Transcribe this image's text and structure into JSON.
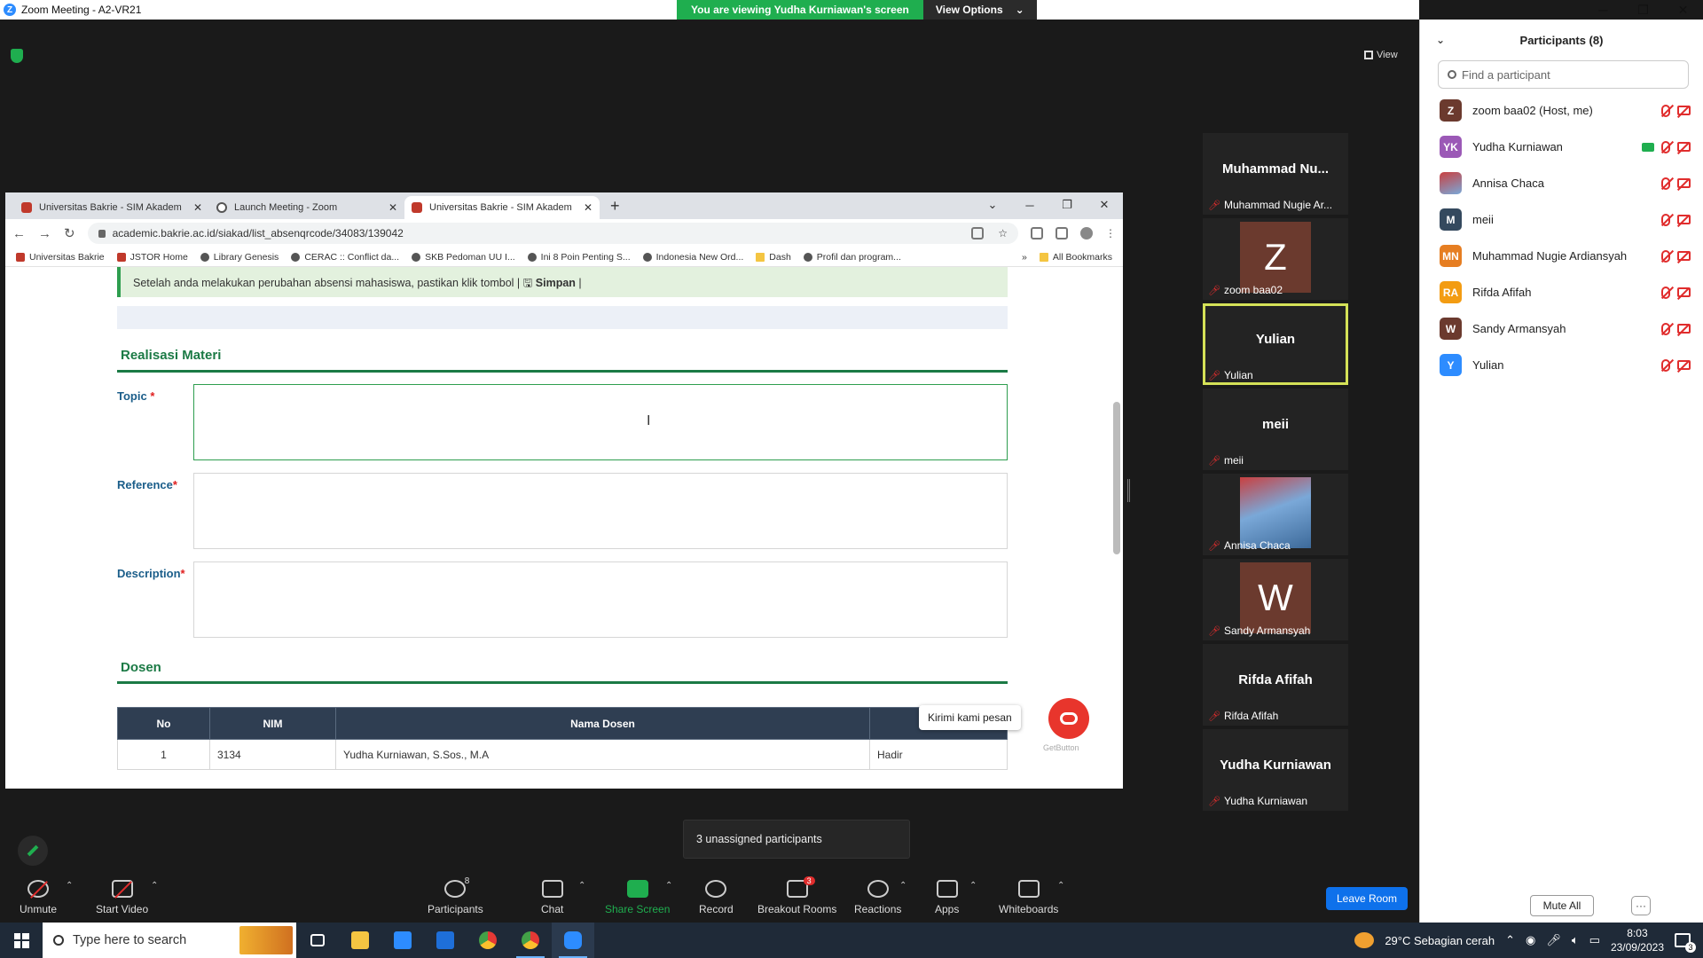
{
  "zoom": {
    "window_title": "Zoom Meeting - A2-VR21",
    "share_banner": "You are viewing Yudha Kurniawan's screen",
    "view_options": "View Options",
    "view_label": "View",
    "unassigned_popup": "3 unassigned participants",
    "leave_room": "Leave Room"
  },
  "browser": {
    "tabs": [
      {
        "title": "Universitas Bakrie - SIM Akadem",
        "active": false
      },
      {
        "title": "Launch Meeting - Zoom",
        "active": false
      },
      {
        "title": "Universitas Bakrie - SIM Akadem",
        "active": true
      }
    ],
    "url": "academic.bakrie.ac.id/siakad/list_absenqrcode/34083/139042",
    "bookmarks": [
      "Universitas Bakrie",
      "JSTOR Home",
      "Library Genesis",
      "CERAC :: Conflict da...",
      "SKB Pedoman UU I...",
      "Ini 8 Poin Penting S...",
      "Indonesia New Ord...",
      "Dash",
      "Profil dan program..."
    ],
    "bookmarks_more": "»",
    "all_bookmarks": "All Bookmarks"
  },
  "page": {
    "alert_text": "Setelah anda melakukan perubahan absensi mahasiswa, pastikan klik tombol |",
    "alert_button": "Simpan",
    "alert_end": "|",
    "section_realisasi": "Realisasi Materi",
    "label_topic": "Topic",
    "label_reference": "Reference",
    "label_description": "Description",
    "required_mark": "*",
    "section_dosen": "Dosen",
    "table_headers": [
      "No",
      "NIM",
      "Nama Dosen",
      ""
    ],
    "table_rows": [
      {
        "no": "1",
        "nim": "3134",
        "nama": "Yudha Kurniawan, S.Sos., M.A",
        "status": "Hadir"
      }
    ],
    "chat_tooltip": "Kirimi kami pesan",
    "getbutton": "GetButton"
  },
  "video_tiles": [
    {
      "big_name": "Muhammad Nu...",
      "label": "Muhammad Nugie Ar...",
      "type": "name"
    },
    {
      "big_name": "Z",
      "label": "zoom baa02",
      "type": "avatar",
      "color": "#6b3a2e"
    },
    {
      "big_name": "Yulian",
      "label": "Yulian",
      "type": "name",
      "active": true
    },
    {
      "big_name": "meii",
      "label": "meii",
      "type": "name"
    },
    {
      "big_name": "",
      "label": "Annisa Chaca",
      "type": "photo"
    },
    {
      "big_name": "W",
      "label": "Sandy Armansyah",
      "type": "avatar",
      "color": "#6b3a2e"
    },
    {
      "big_name": "Rifda Afifah",
      "label": "Rifda Afifah",
      "type": "name"
    },
    {
      "big_name": "Yudha Kurniawan",
      "label": "Yudha Kurniawan",
      "type": "name"
    }
  ],
  "toolbar": {
    "unmute": "Unmute",
    "start_video": "Start Video",
    "participants": "Participants",
    "participants_count": "8",
    "chat": "Chat",
    "share_screen": "Share Screen",
    "record": "Record",
    "breakout_rooms": "Breakout Rooms",
    "breakout_badge": "3",
    "reactions": "Reactions",
    "apps": "Apps",
    "whiteboards": "Whiteboards"
  },
  "participants": {
    "title": "Participants (8)",
    "search_placeholder": "Find a participant",
    "mute_all": "Mute All",
    "more": "···",
    "list": [
      {
        "initials": "Z",
        "name": "zoom baa02 (Host, me)",
        "color": "#6b3a2e",
        "sharing": false
      },
      {
        "initials": "YK",
        "name": "Yudha Kurniawan",
        "color": "#9b59b6",
        "sharing": true
      },
      {
        "initials": "",
        "name": "Annisa Chaca",
        "color": "#5b7fa8",
        "sharing": false
      },
      {
        "initials": "M",
        "name": "meii",
        "color": "#34495e",
        "sharing": false
      },
      {
        "initials": "MN",
        "name": "Muhammad Nugie Ardiansyah",
        "color": "#e67e22",
        "sharing": false
      },
      {
        "initials": "RA",
        "name": "Rifda Afifah",
        "color": "#f39c12",
        "sharing": false
      },
      {
        "initials": "W",
        "name": "Sandy Armansyah",
        "color": "#6b3a2e",
        "sharing": false
      },
      {
        "initials": "Y",
        "name": "Yulian",
        "color": "#2d8cff",
        "sharing": false
      }
    ]
  },
  "taskbar": {
    "search_placeholder": "Type here to search",
    "weather": "29°C  Sebagian cerah",
    "time": "8:03",
    "date": "23/09/2023",
    "notifications": "3"
  }
}
